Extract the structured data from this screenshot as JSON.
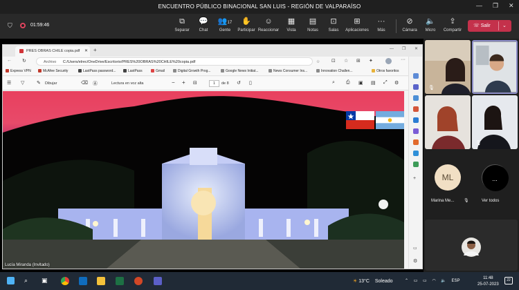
{
  "teams": {
    "window_title": "ENCUENTRO PÚBLICO BINACIONAL SAN LUIS - REGIÓN DE VALPARAÍSO",
    "timer": "01:59:46",
    "toolbar": [
      {
        "label": "Separar",
        "icon": "pop-out-icon"
      },
      {
        "label": "Chat",
        "icon": "chat-icon"
      },
      {
        "label": "Gente",
        "icon": "people-icon",
        "badge": "17"
      },
      {
        "label": "Participar",
        "icon": "raise-hand-icon"
      },
      {
        "label": "Reaccionar",
        "icon": "react-icon"
      },
      {
        "label": "Vista",
        "icon": "view-icon"
      },
      {
        "label": "Notas",
        "icon": "notes-icon"
      },
      {
        "label": "Salas",
        "icon": "rooms-icon"
      },
      {
        "label": "Aplicaciones",
        "icon": "apps-icon"
      },
      {
        "label": "Más",
        "icon": "more-icon"
      },
      {
        "label": "Cámara",
        "icon": "camera-off-icon"
      },
      {
        "label": "Micro",
        "icon": "mic-icon"
      },
      {
        "label": "Compartir",
        "icon": "share-icon"
      }
    ],
    "leave_label": "Salir",
    "leave_color": "#c4314b"
  },
  "browser": {
    "tab_title": "PRES OBRAS CHILE copia.pdf",
    "address_prefix": "Archivo",
    "address": "C:/Users/elrec/OneDrive/Escritorio/PRES%20OBRAS%20CHILE%20copia.pdf",
    "favorites": [
      "Express VPN",
      "McAfee Security",
      "LastPass password...",
      "LastPass",
      "Gmail",
      "Digital Growth Prog...",
      "Google News Initiat...",
      "News Consumer Ins...",
      "Innovation Challen...",
      "Otros favoritos"
    ],
    "pdf_toolbar": {
      "draw_label": "Dibujar",
      "read_aloud_label": "Lectura en voz alta",
      "page_current": "1",
      "page_total": "de 8"
    }
  },
  "presenter_label": "Lucía Miranda (Invitado)",
  "participants": [
    {
      "name": "Marina Me...",
      "initials": "ML",
      "avatar_color": "#f1dfc4"
    },
    {
      "name": "Ver todos",
      "initials": "...",
      "avatar_color": "#000000"
    }
  ],
  "taskbar": {
    "weather_temp": "13°C",
    "weather_text": "Soleado",
    "language": "ESP",
    "time": "11:48",
    "date": "25-07-2023",
    "notifications": "22"
  }
}
